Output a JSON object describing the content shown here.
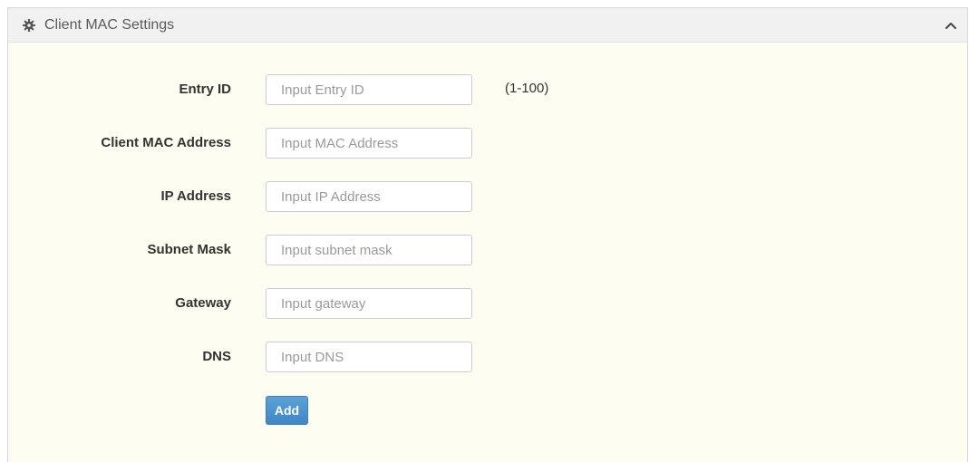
{
  "panel": {
    "title": "Client MAC Settings",
    "header_icon": "gear-icon",
    "collapse_icon": "chevron-up-icon"
  },
  "form": {
    "fields": [
      {
        "label": "Entry ID",
        "placeholder": "Input Entry ID",
        "value": "",
        "hint": "(1-100)"
      },
      {
        "label": "Client MAC Address",
        "placeholder": "Input MAC Address",
        "value": ""
      },
      {
        "label": "IP Address",
        "placeholder": "Input IP Address",
        "value": ""
      },
      {
        "label": "Subnet Mask",
        "placeholder": "Input subnet mask",
        "value": ""
      },
      {
        "label": "Gateway",
        "placeholder": "Input gateway",
        "value": ""
      },
      {
        "label": "DNS",
        "placeholder": "Input DNS",
        "value": ""
      }
    ],
    "add_label": "Add"
  },
  "colors": {
    "panel_background": "#fdfdf2",
    "header_background": "#f1f1f1",
    "button_accent": "#4a90d0"
  }
}
